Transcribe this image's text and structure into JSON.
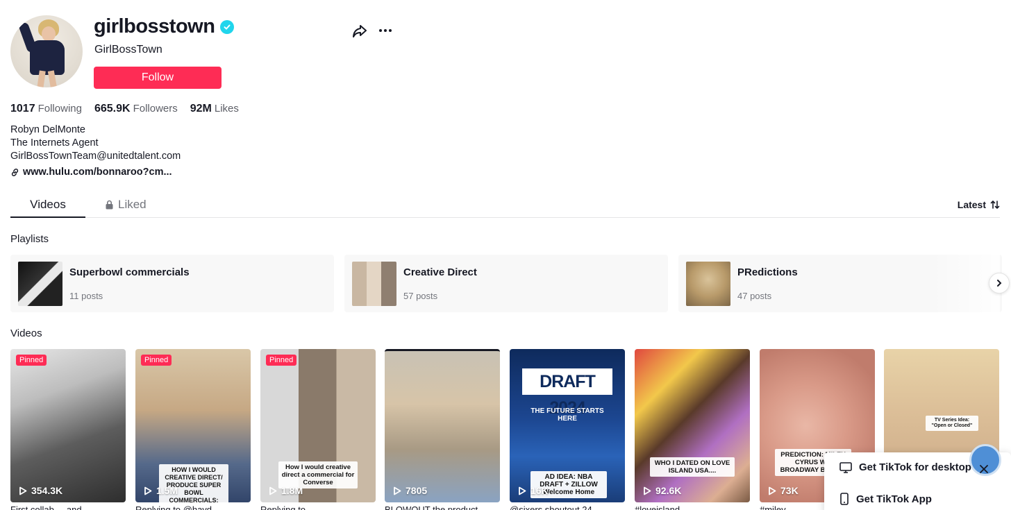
{
  "profile": {
    "username": "girlbosstown",
    "nickname": "GirlBossTown",
    "follow_label": "Follow",
    "stats": [
      {
        "value": "1017",
        "label": "Following"
      },
      {
        "value": "665.9K",
        "label": "Followers"
      },
      {
        "value": "92M",
        "label": "Likes"
      }
    ],
    "bio": [
      "Robyn DelMonte",
      "The Internets Agent",
      "GirlBossTownTeam@unitedtalent.com"
    ],
    "link": "www.hulu.com/bonnaroo?cm..."
  },
  "tabs": {
    "videos": "Videos",
    "liked": "Liked",
    "sort": "Latest"
  },
  "playlists": {
    "title": "Playlists",
    "items": [
      {
        "name": "Superbowl commercials",
        "count": "11 posts"
      },
      {
        "name": "Creative Direct",
        "count": "57 posts"
      },
      {
        "name": "PRedictions",
        "count": "47 posts"
      }
    ]
  },
  "videos": {
    "title": "Videos",
    "pinned_label": "Pinned",
    "items": [
      {
        "views": "354.3K",
        "caption": "First collab ... and"
      },
      {
        "views": "1.5M",
        "caption": "Replying to @hayd...",
        "overlay": "HOW I WOULD CREATIVE DIRECT/ PRODUCE SUPER BOWL COMMERCIALS: UBER"
      },
      {
        "views": "1.8M",
        "caption": "Replying to ...",
        "overlay": "How I would creative direct a commercial for Converse"
      },
      {
        "views": "7805",
        "caption": "BLOWOUT the product ..."
      },
      {
        "views": "16K",
        "caption": "@sixers shoutout 24 ...",
        "overlay": "AD IDEA: NBA DRAFT + ZILLOW Welcome Home",
        "banner": "DRAFT 2024",
        "sub": "THE FUTURE STARTS HERE"
      },
      {
        "views": "92.6K",
        "caption": "#loveisland ...",
        "overlay": "WHO I DATED ON LOVE ISLAND USA...."
      },
      {
        "views": "73K",
        "caption": "#miley ...",
        "overlay": "PREDICTION: MILEY CYRUS W... BROADWAY BY 2025"
      },
      {
        "views": "",
        "caption": "",
        "overlay": "TV Series Idea: \"Open or Closed\""
      }
    ]
  },
  "get_app": {
    "desktop": "Get TikTok for desktop",
    "app": "Get TikTok App"
  },
  "colors": {
    "accent": "#fe2c55",
    "verified": "#20d5ec"
  }
}
